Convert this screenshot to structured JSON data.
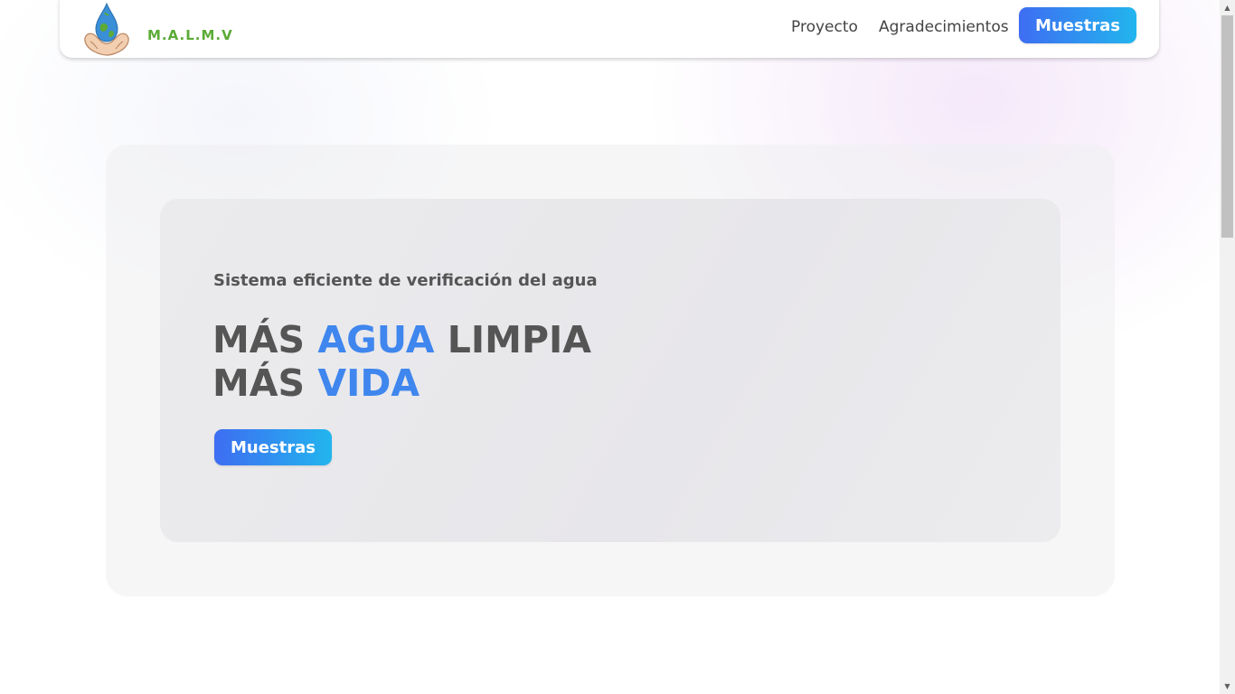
{
  "header": {
    "logo_text": "M.A.L.M.V",
    "nav": [
      {
        "label": "Proyecto"
      },
      {
        "label": "Agradecimientos"
      }
    ],
    "cta_label": "Muestras"
  },
  "hero": {
    "subtitle": "Sistema eficiente de verificación del agua",
    "line1_word1": "MÁS",
    "line1_accent": "AGUA",
    "line1_word3": "LIMPIA",
    "line2_word1": "MÁS",
    "line2_accent": "VIDA",
    "cta_label": "Muestras"
  },
  "colors": {
    "accent": "#3f86ee",
    "button_gradient_start": "#3e6df2",
    "button_gradient_end": "#22b5ee",
    "logo_green": "#5cab37",
    "text": "#555555"
  },
  "icons": {
    "logo": "water-drop-earth-in-hands-icon",
    "scroll_up": "scroll-up-arrow-icon",
    "scroll_down": "scroll-down-arrow-icon"
  }
}
